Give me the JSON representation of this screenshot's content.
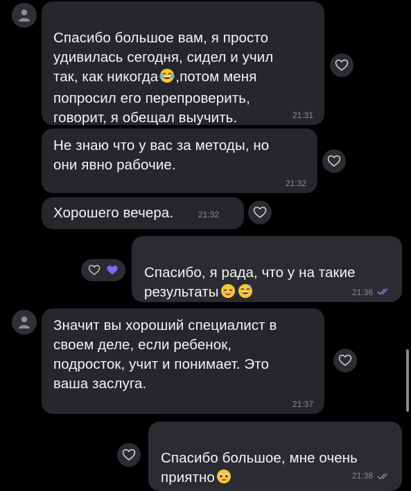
{
  "messages": [
    {
      "text": "Спасибо большое вам, я просто\nудивилась сегодня, сидел и учил\nтак, как никогда",
      "text2": ",потом меня\nпопросил его перепроверить,\nговорит, я обещал выучить.",
      "time": "21:31"
    },
    {
      "text": "Не знаю что у вас за методы, но\nони явно рабочие.",
      "time": "21:32"
    },
    {
      "text": "Хорошего вечера.",
      "time": "21:32"
    },
    {
      "text": "Спасибо, я рада, что у на такие\nрезультаты",
      "time": "21:36"
    },
    {
      "text": "Значит вы хороший специалист в\nсвоем деле, если ребенок,\nподросток, учит и понимает. Это\nваша заслуга.",
      "time": "21:37"
    },
    {
      "text": "Спасибо большое, мне очень\nприятно",
      "time": "21:38"
    }
  ],
  "icons": {
    "avatar": "person-icon",
    "reaction": "heart-outline-icon",
    "reaction_active": "heart-filled-icon",
    "read": "double-check-icon"
  },
  "colors": {
    "background": "#000000",
    "bubble": "#26272b",
    "heart_active": "#7c6cf2",
    "check": "#8a84e8"
  }
}
